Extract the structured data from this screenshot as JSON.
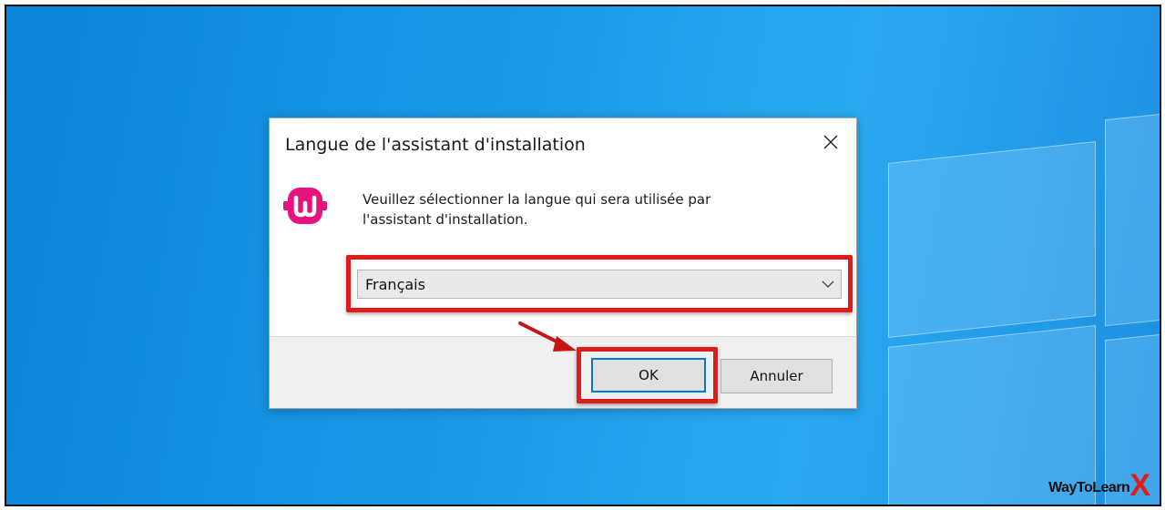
{
  "dialog": {
    "title": "Langue de l'assistant d'installation",
    "message": "Veuillez sélectionner la langue qui sera utilisée par l'assistant d'installation.",
    "language_select": {
      "value": "Français"
    },
    "ok_label": "OK",
    "cancel_label": "Annuler"
  },
  "watermark": {
    "text": "WayToLearn",
    "suffix": "X"
  },
  "colors": {
    "accent": "#0078d7",
    "highlight": "#e01b1b",
    "logo": "#e6137e",
    "desktop": "#1a98e6"
  },
  "icons": [
    "close-icon",
    "wampserver-logo",
    "chevron-down-icon",
    "red-arrow"
  ]
}
